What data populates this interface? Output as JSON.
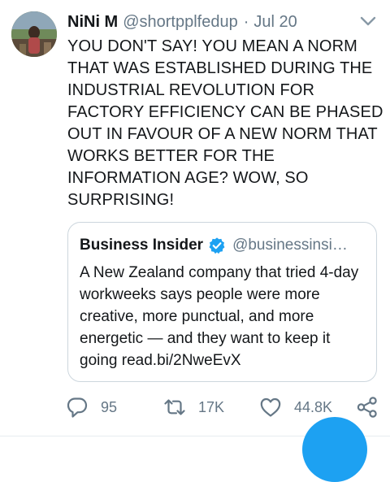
{
  "tweet": {
    "display_name": "NiNi M",
    "handle": "@shortpplfedup",
    "separator": "·",
    "date": "Jul 20",
    "text": "YOU DON'T SAY! YOU MEAN A NORM THAT WAS ESTABLISHED DURING THE INDUSTRIAL REVOLUTION FOR FACTORY EFFICIENCY CAN BE PHASED OUT IN FAVOUR OF A NEW NORM THAT WORKS BETTER FOR THE INFORMATION AGE? WOW, SO SURPRISING!"
  },
  "quoted_tweet": {
    "display_name": "Business Insider",
    "handle": "@businessinsi…",
    "verified_icon": "verified-badge-icon",
    "text": "A New Zealand company that tried 4-day workweeks says people were more creative, more punctual, and more energetic — and they want to keep it going read.bi/2NweEvX"
  },
  "actions": {
    "reply": {
      "icon": "reply-icon",
      "count": "95"
    },
    "retweet": {
      "icon": "retweet-icon",
      "count": "17K"
    },
    "like": {
      "icon": "heart-icon",
      "count": "44.8K"
    },
    "share": {
      "icon": "share-icon"
    }
  },
  "colors": {
    "text": "#14171a",
    "secondary": "#657786",
    "border": "#ccd6dd",
    "accent": "#1da1f2",
    "divider": "#e6ecf0"
  }
}
